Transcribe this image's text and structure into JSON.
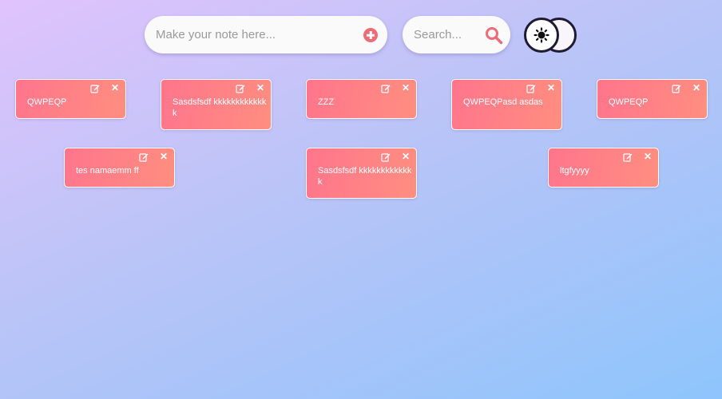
{
  "header": {
    "note_input": {
      "placeholder": "Make your note here...",
      "value": ""
    },
    "add_icon": "plus-circle-icon",
    "search": {
      "placeholder": "Search...",
      "value": ""
    },
    "search_icon": "magnifier-icon",
    "theme_toggle_icon": "sun-icon"
  },
  "notes": [
    {
      "text": "QWPEQP",
      "close": "✕"
    },
    {
      "text": "Sasdsfsdf kkkkkkkkkkkkk",
      "close": "✕"
    },
    {
      "text": "ZZZ",
      "close": "✕"
    },
    {
      "text": "QWPEQPasd asdas",
      "close": "✕"
    },
    {
      "text": "QWPEQP",
      "close": "✕"
    },
    {
      "text": "tes namaemm ff",
      "close": "✕"
    },
    {
      "text": "Sasdsfsdf kkkkkkkkkkkkk",
      "close": "✕"
    },
    {
      "text": "ltgfyyyy",
      "close": "✕"
    }
  ],
  "colors": {
    "note_gradient_start": "#ff758c",
    "note_gradient_end": "#ff8e80",
    "accent": "#f06b78",
    "toggle_border": "#1e1a32"
  }
}
